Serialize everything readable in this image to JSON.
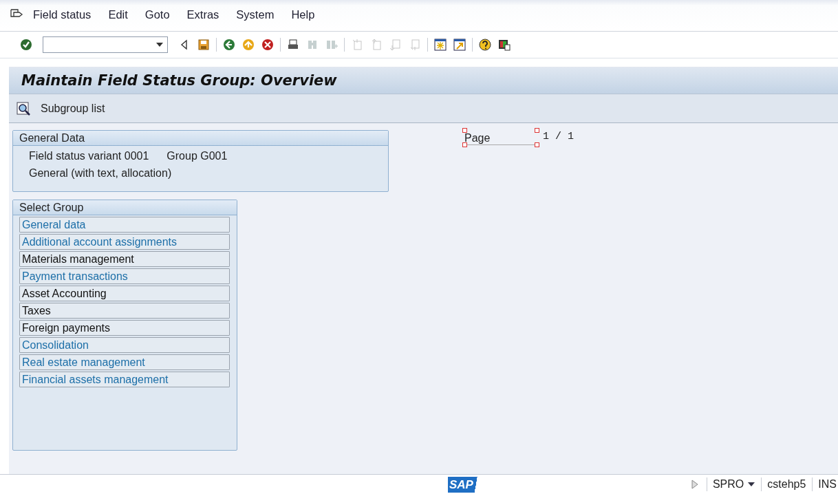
{
  "menu": [
    "Field status",
    "Edit",
    "Goto",
    "Extras",
    "System",
    "Help"
  ],
  "toolbar": [
    {
      "kind": "enter",
      "disabled": false
    },
    {
      "kind": "command-field"
    },
    {
      "kind": "collapse",
      "disabled": false
    },
    {
      "kind": "save",
      "disabled": false
    },
    {
      "kind": "sep"
    },
    {
      "kind": "back",
      "disabled": false
    },
    {
      "kind": "exit",
      "disabled": false
    },
    {
      "kind": "cancel",
      "disabled": false
    },
    {
      "kind": "sep"
    },
    {
      "kind": "print",
      "disabled": false
    },
    {
      "kind": "find",
      "disabled": true
    },
    {
      "kind": "find-next",
      "disabled": true
    },
    {
      "kind": "sep"
    },
    {
      "kind": "first-page",
      "disabled": true
    },
    {
      "kind": "prev-page",
      "disabled": true
    },
    {
      "kind": "next-page",
      "disabled": true
    },
    {
      "kind": "last-page",
      "disabled": true
    },
    {
      "kind": "sep"
    },
    {
      "kind": "new-session",
      "disabled": false
    },
    {
      "kind": "shortcut",
      "disabled": false
    },
    {
      "kind": "sep"
    },
    {
      "kind": "help",
      "disabled": false
    },
    {
      "kind": "layout",
      "disabled": false
    }
  ],
  "title": "Maintain Field Status Group: Overview",
  "app_toolbar": [
    {
      "label": "Subgroup list"
    }
  ],
  "general_data": {
    "heading": "General Data",
    "variant_label": "Field status variant",
    "variant": "0001",
    "group_label": "Group",
    "group": "G001",
    "description": "General (with text, allocation)"
  },
  "page_indicator": {
    "label": "Page",
    "value": "1 / 1"
  },
  "select_group": {
    "heading": "Select Group",
    "items": [
      {
        "label": "General data",
        "kind": "link"
      },
      {
        "label": "Additional account assignments",
        "kind": "link"
      },
      {
        "label": "Materials management",
        "kind": "plain"
      },
      {
        "label": "Payment transactions",
        "kind": "link"
      },
      {
        "label": "Asset Accounting",
        "kind": "plain"
      },
      {
        "label": "Taxes",
        "kind": "plain"
      },
      {
        "label": "Foreign payments",
        "kind": "plain"
      },
      {
        "label": "Consolidation",
        "kind": "link"
      },
      {
        "label": "Real estate management",
        "kind": "link"
      },
      {
        "label": "Financial assets management",
        "kind": "link"
      }
    ]
  },
  "status_bar": {
    "logo": "SAP",
    "transaction": "SPRO",
    "server": "cstehp5",
    "mode": "INS"
  }
}
